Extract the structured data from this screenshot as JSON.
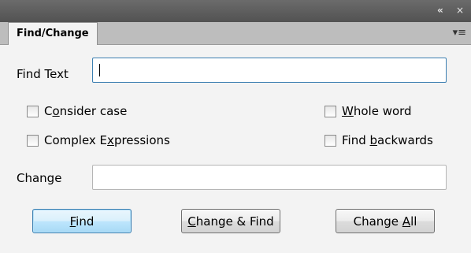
{
  "window": {
    "collapse_glyph": "«",
    "close_glyph": "×",
    "menu_glyph": "▾≡"
  },
  "tab": {
    "label": "Find/Change"
  },
  "find": {
    "label": "Find Text",
    "value": ""
  },
  "options": {
    "consider_case": {
      "pre": "C",
      "u": "o",
      "post": "nsider case",
      "checked": false
    },
    "whole_word": {
      "pre": "",
      "u": "W",
      "post": "hole word",
      "checked": false
    },
    "complex_expressions": {
      "pre": "Complex E",
      "u": "x",
      "post": "pressions",
      "checked": false
    },
    "find_backwards": {
      "pre": "Find ",
      "u": "b",
      "post": "ackwards",
      "checked": false
    }
  },
  "change": {
    "label": "Change",
    "value": ""
  },
  "buttons": {
    "find": {
      "pre": "",
      "u": "F",
      "post": "ind"
    },
    "change_find": {
      "pre": "",
      "u": "C",
      "post": "hange & Find"
    },
    "change_all": {
      "pre": "Change ",
      "u": "A",
      "post": "ll"
    }
  }
}
